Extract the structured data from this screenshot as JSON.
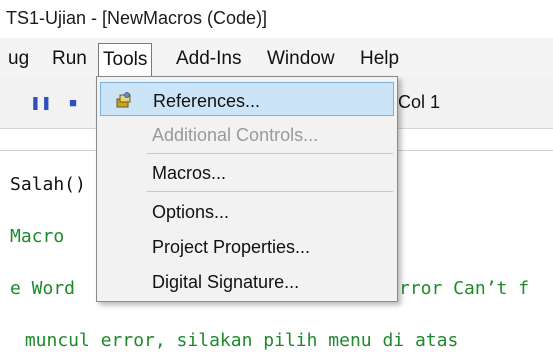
{
  "window": {
    "title": "TS1-Ujian - [NewMacros (Code)]"
  },
  "menubar": {
    "items": [
      {
        "label": "ug"
      },
      {
        "label": "Run"
      },
      {
        "label": "Tools"
      },
      {
        "label": "Add-Ins"
      },
      {
        "label": "Window"
      },
      {
        "label": "Help"
      }
    ]
  },
  "toolbar": {
    "position": "Col 1"
  },
  "tools_menu": {
    "items": [
      {
        "label": "References...",
        "state": "highlighted",
        "icon": "references-icon"
      },
      {
        "label": "Additional Controls...",
        "state": "disabled"
      },
      {
        "label": "Macros..."
      },
      {
        "label": "Options..."
      },
      {
        "label": "Project Properties..."
      },
      {
        "label": "Digital Signature..."
      }
    ]
  },
  "code": {
    "lines": [
      "Salah()",
      "Macro",
      "e Word",
      "rror Can’t f",
      " muncul error, silakan pilih menu di atas"
    ]
  },
  "colors": {
    "highlight": "#cce4f7",
    "comment_green": "#1e8a2b",
    "toolbar_blue": "#2e4fc0"
  }
}
